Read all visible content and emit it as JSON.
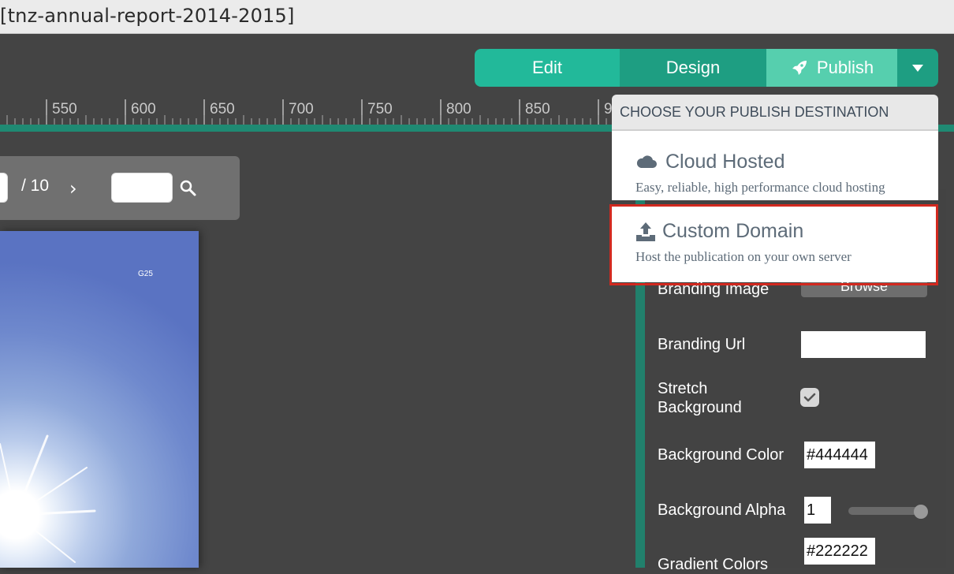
{
  "window": {
    "title": "[tnz-annual-report-2014-2015]"
  },
  "toolbar": {
    "edit_label": "Edit",
    "design_label": "Design",
    "publish_label": "Publish",
    "colors": {
      "edit": "#22b99a",
      "design": "#1e9e82",
      "publish": "#56cfae"
    }
  },
  "ruler": {
    "labels": [
      "550",
      "600",
      "650",
      "700",
      "750",
      "800",
      "850",
      "9"
    ]
  },
  "pager": {
    "total": "/ 10",
    "next": "›"
  },
  "preview": {
    "corner_label": "G25"
  },
  "publish_menu": {
    "header": "CHOOSE YOUR PUBLISH DESTINATION",
    "options": [
      {
        "title": "Cloud Hosted",
        "description": "Easy, reliable, high performance cloud hosting",
        "icon": "cloud-icon"
      },
      {
        "title": "Custom Domain",
        "description": "Host the publication on your own server",
        "icon": "upload-icon",
        "highlighted": true
      }
    ]
  },
  "properties": {
    "branding_image_label": "Branding Image",
    "browse_label": "Browse",
    "branding_url_label": "Branding Url",
    "branding_url_value": "",
    "stretch_label_line1": "Stretch",
    "stretch_label_line2": "Background",
    "stretch_checked": true,
    "bg_color_label": "Background Color",
    "bg_color_value": "#444444",
    "bg_alpha_label": "Background Alpha",
    "bg_alpha_value": "1",
    "gradient_label": "Gradient Colors",
    "gradient_value": "#222222"
  }
}
